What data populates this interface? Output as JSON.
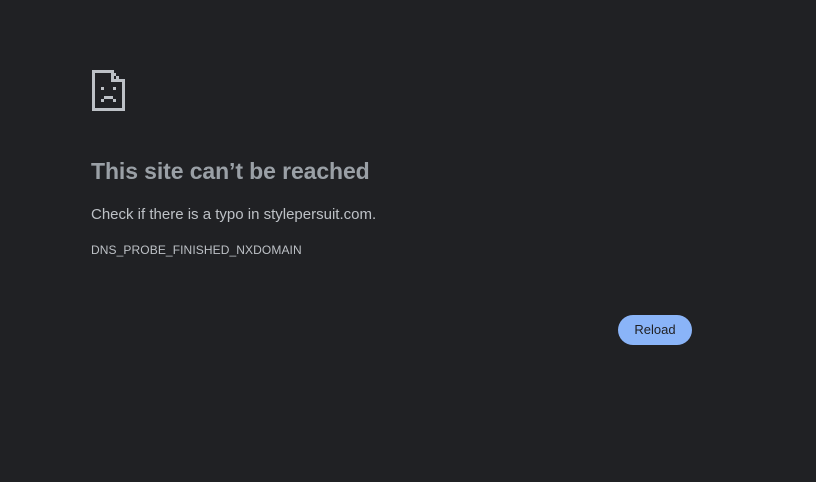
{
  "page": {
    "icon": "sad-document-icon",
    "title": "This site can’t be reached",
    "suggestion": "Check if there is a typo in stylepersuit.com.",
    "error_code": "DNS_PROBE_FINISHED_NXDOMAIN",
    "reload_label": "Reload"
  },
  "colors": {
    "background": "#202124",
    "title": "#9aa0a6",
    "body_text": "#bdc1c6",
    "button_bg": "#8ab4f8",
    "button_text": "#202124"
  }
}
